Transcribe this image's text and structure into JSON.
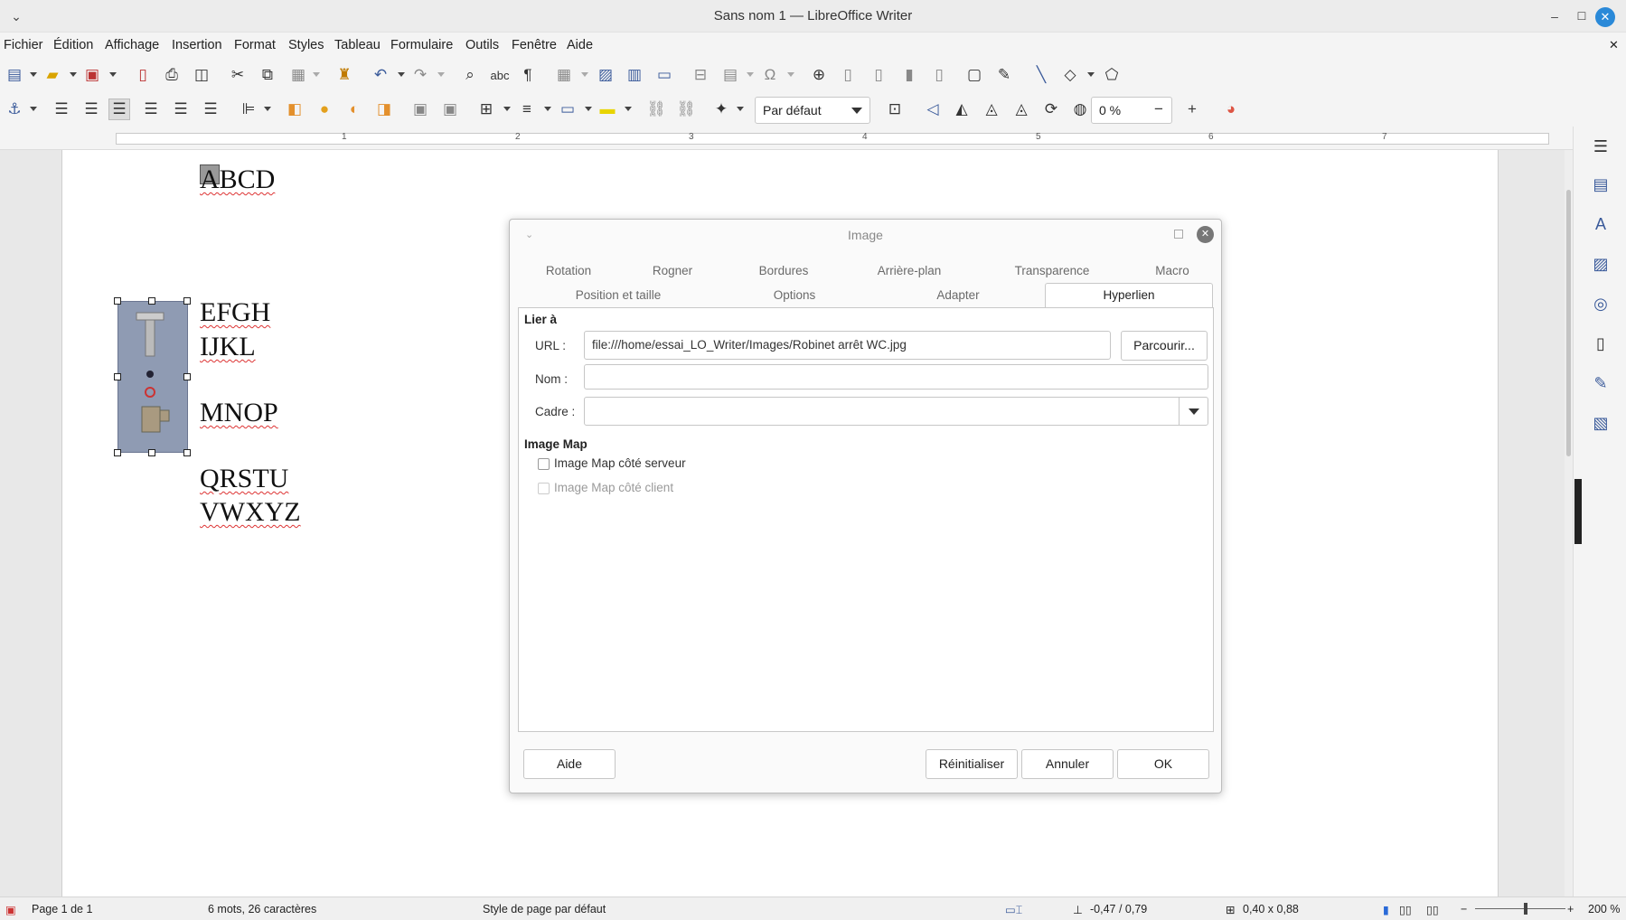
{
  "window": {
    "title": "Sans nom 1 — LibreOffice Writer"
  },
  "menu": [
    "Fichier",
    "Édition",
    "Affichage",
    "Insertion",
    "Format",
    "Styles",
    "Tableau",
    "Formulaire",
    "Outils",
    "Fenêtre",
    "Aide"
  ],
  "toolbar2": {
    "style_combo": "Par défaut",
    "transparency_value": "0 %"
  },
  "ruler": {
    "numbers": [
      "1",
      "2",
      "3",
      "4",
      "5",
      "6",
      "7"
    ]
  },
  "document": {
    "lines": [
      "ABCD",
      "EFGH",
      "IJKL",
      "MNOP",
      "QRSTU",
      "VWXYZ"
    ]
  },
  "dialog": {
    "title": "Image",
    "tabs_row1": [
      "Rotation",
      "Rogner",
      "Bordures",
      "Arrière-plan",
      "Transparence",
      "Macro"
    ],
    "tabs_row2": [
      "Position et taille",
      "Options",
      "Adapter",
      "Hyperlien"
    ],
    "active_tab": "Hyperlien",
    "section_link": "Lier à",
    "url_label": "URL :",
    "url_value": "file:///home/essai_LO_Writer/Images/Robinet arrêt WC.jpg",
    "browse_button": "Parcourir...",
    "name_label": "Nom :",
    "name_value": "",
    "frame_label": "Cadre :",
    "frame_value": "",
    "section_imagemap": "Image Map",
    "server_map": "Image Map côté serveur",
    "client_map": "Image Map côté client",
    "help_button": "Aide",
    "reset_button": "Réinitialiser",
    "cancel_button": "Annuler",
    "ok_button": "OK"
  },
  "status": {
    "page": "Page 1 de 1",
    "words": "6 mots, 26 caractères",
    "page_style": "Style de page par défaut",
    "position": "-0,47 / 0,79",
    "size": "0,40 x 0,88",
    "zoom": "200 %"
  }
}
